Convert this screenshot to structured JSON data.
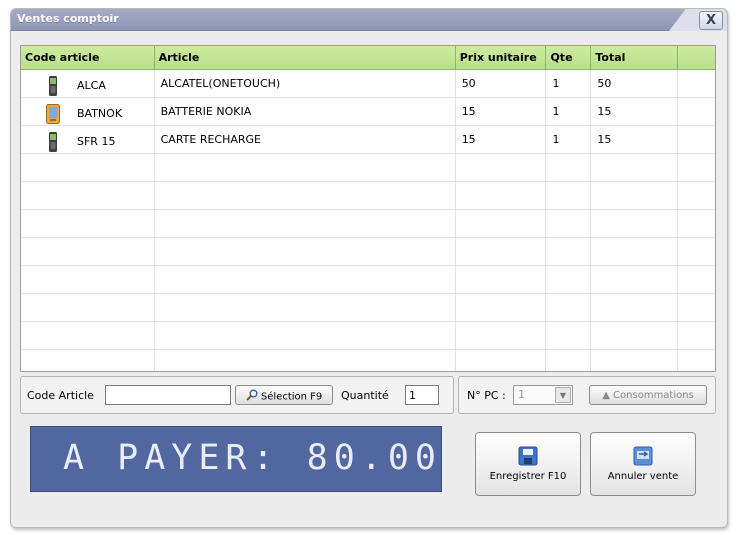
{
  "window": {
    "title": "Ventes comptoir",
    "close_label": "X"
  },
  "table": {
    "columns": [
      "Code article",
      "Article",
      "Prix unitaire",
      "Qte",
      "Total",
      ""
    ],
    "rows": [
      {
        "code": "ALCA",
        "article": "ALCATEL(ONETOUCH)",
        "prix": "50",
        "qte": "1",
        "total": "50",
        "icon": "mobile-phone-icon"
      },
      {
        "code": "BATNOK",
        "article": "BATTERIE NOKIA",
        "prix": "15",
        "qte": "1",
        "total": "15",
        "icon": "battery-icon"
      },
      {
        "code": "SFR 15",
        "article": "CARTE RECHARGE",
        "prix": "15",
        "qte": "1",
        "total": "15",
        "icon": "mobile-phone-icon"
      }
    ]
  },
  "toolbar": {
    "code_article_label": "Code Article",
    "code_article_value": "",
    "selection_label": "Sélection F9",
    "quantite_label": "Quantité",
    "quantite_value": "1",
    "npc_label": "N° PC :",
    "npc_value": "1",
    "consommations_label": "▲ Consommations"
  },
  "payment": {
    "text": "A PAYER: 80.00"
  },
  "buttons": {
    "enregistrer_label": "Enregistrer F10",
    "annuler_label": "Annuler vente"
  },
  "colors": {
    "header_green": "#b9e08a",
    "pay_panel": "#52679f",
    "titlebar": "#8f95b4"
  }
}
